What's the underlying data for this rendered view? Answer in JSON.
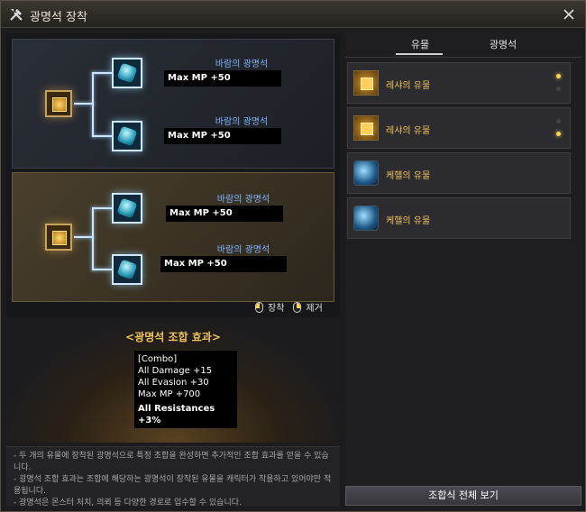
{
  "window": {
    "title": "광명석 장착"
  },
  "left": {
    "groups": [
      {
        "gems": [
          {
            "name": "바람의 광명석",
            "stat": "Max MP +50"
          },
          {
            "name": "바람의 광명석",
            "stat": "Max MP +50"
          }
        ]
      },
      {
        "gems": [
          {
            "name": "바람의 광명석",
            "stat": "Max MP +50"
          },
          {
            "name": "바람의 광명석",
            "stat": "Max MP +50"
          }
        ]
      }
    ],
    "legend": {
      "equip": "장착",
      "remove": "제거"
    }
  },
  "combo": {
    "title": "<광명석 조합 효과>",
    "lines": [
      "[Combo]",
      "All Damage +15",
      "All Evasion +30",
      "Max MP +700",
      "All Resistances +3%"
    ]
  },
  "info": {
    "lines": [
      "- 두 개의 유물에 장착된 광명석으로 특정 조합을 완성하면 추가적인 조합 효과를 얻을 수 있습니다.",
      "- 광명석 조합 효과는 조합에 해당하는 광명석이 장착된 유물을 캐릭터가 착용하고 있어야만 적용됩니다.",
      "- 광명석은 몬스터 처치, 의뢰 등 다양한 경로로 입수할 수 있습니다."
    ]
  },
  "right": {
    "tabs": [
      "유물",
      "광명석"
    ],
    "active_tab": "유물",
    "items": [
      {
        "label": "레샤의 유물",
        "icon": "relic-icon",
        "dots": [
          true,
          false
        ]
      },
      {
        "label": "레샤의 유물",
        "icon": "relic-icon",
        "dots": [
          false,
          true
        ]
      },
      {
        "label": "케헬의 유물",
        "icon": "orb-icon",
        "dots": []
      },
      {
        "label": "케헬의 유물",
        "icon": "orb-icon",
        "dots": []
      }
    ],
    "view_all_button": "조합식 전체 보기"
  }
}
